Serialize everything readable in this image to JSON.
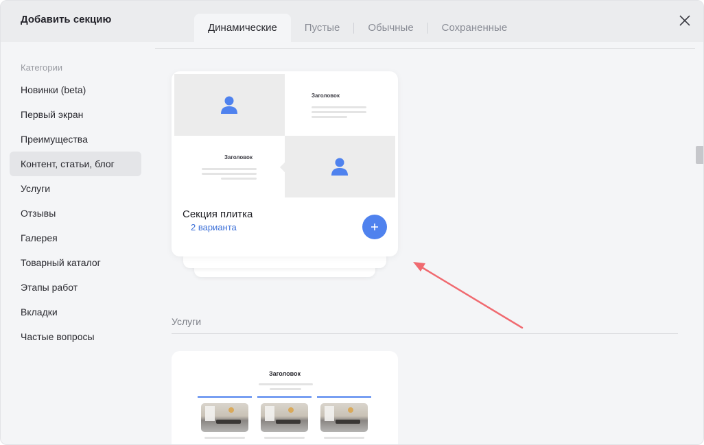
{
  "dialog": {
    "title": "Добавить секцию"
  },
  "tabs": [
    {
      "label": "Динамические",
      "active": true
    },
    {
      "label": "Пустые",
      "active": false
    },
    {
      "label": "Обычные",
      "active": false
    },
    {
      "label": "Сохраненные",
      "active": false
    }
  ],
  "sidebar": {
    "heading": "Категории",
    "items": [
      {
        "label": "Новинки (beta)"
      },
      {
        "label": "Первый экран"
      },
      {
        "label": "Преимущества"
      },
      {
        "label": "Контент, статьи, блог",
        "active": true
      },
      {
        "label": "Услуги"
      },
      {
        "label": "Отзывы"
      },
      {
        "label": "Галерея"
      },
      {
        "label": "Товарный каталог"
      },
      {
        "label": "Этапы работ"
      },
      {
        "label": "Вкладки"
      },
      {
        "label": "Частые вопросы"
      }
    ]
  },
  "cards": {
    "tile": {
      "preview_heading_1": "Заголовок",
      "preview_heading_2": "Заголовок",
      "title": "Секция плитка",
      "variants": "2 варианта",
      "add_icon": "plus-icon"
    },
    "services": {
      "section_label": "Услуги",
      "preview_heading": "Заголовок"
    }
  },
  "colors": {
    "accent": "#4f82ee",
    "link": "#3b6fd8",
    "arrow": "#f06a70"
  }
}
